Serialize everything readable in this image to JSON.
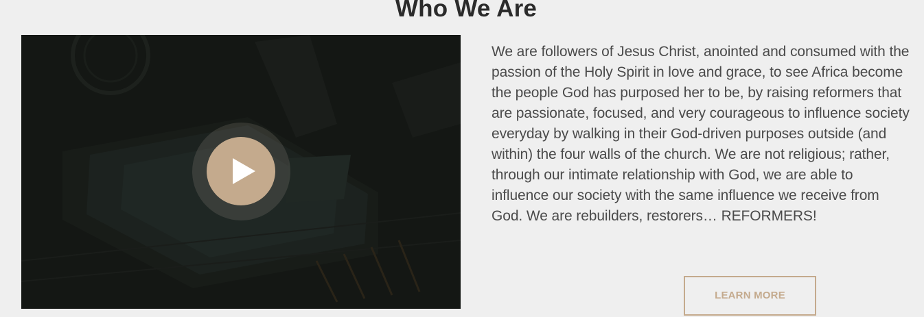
{
  "section": {
    "title": "Who We Are"
  },
  "video": {
    "play_icon": "play-icon",
    "overlay_color": "#141714"
  },
  "about": {
    "paragraph": "We are followers of Jesus Christ, anointed and consumed with the passion of the Holy Spirit in love and grace, to see Africa become the people God has purposed her to be, by raising reformers that are passionate, focused, and very courageous to influence society everyday by walking in their God-driven purposes outside (and within) the four walls of the church. We are not religious; rather, through our intimate relationship with God, we are able to influence our society with the same influence we receive from God. We are rebuilders, restorers… REFORMERS!"
  },
  "cta": {
    "label": "LEARN MORE"
  },
  "colors": {
    "background": "#efefef",
    "accent": "#c4aa8d",
    "heading": "#2b2b2b",
    "body_text": "#4a4a4a"
  }
}
